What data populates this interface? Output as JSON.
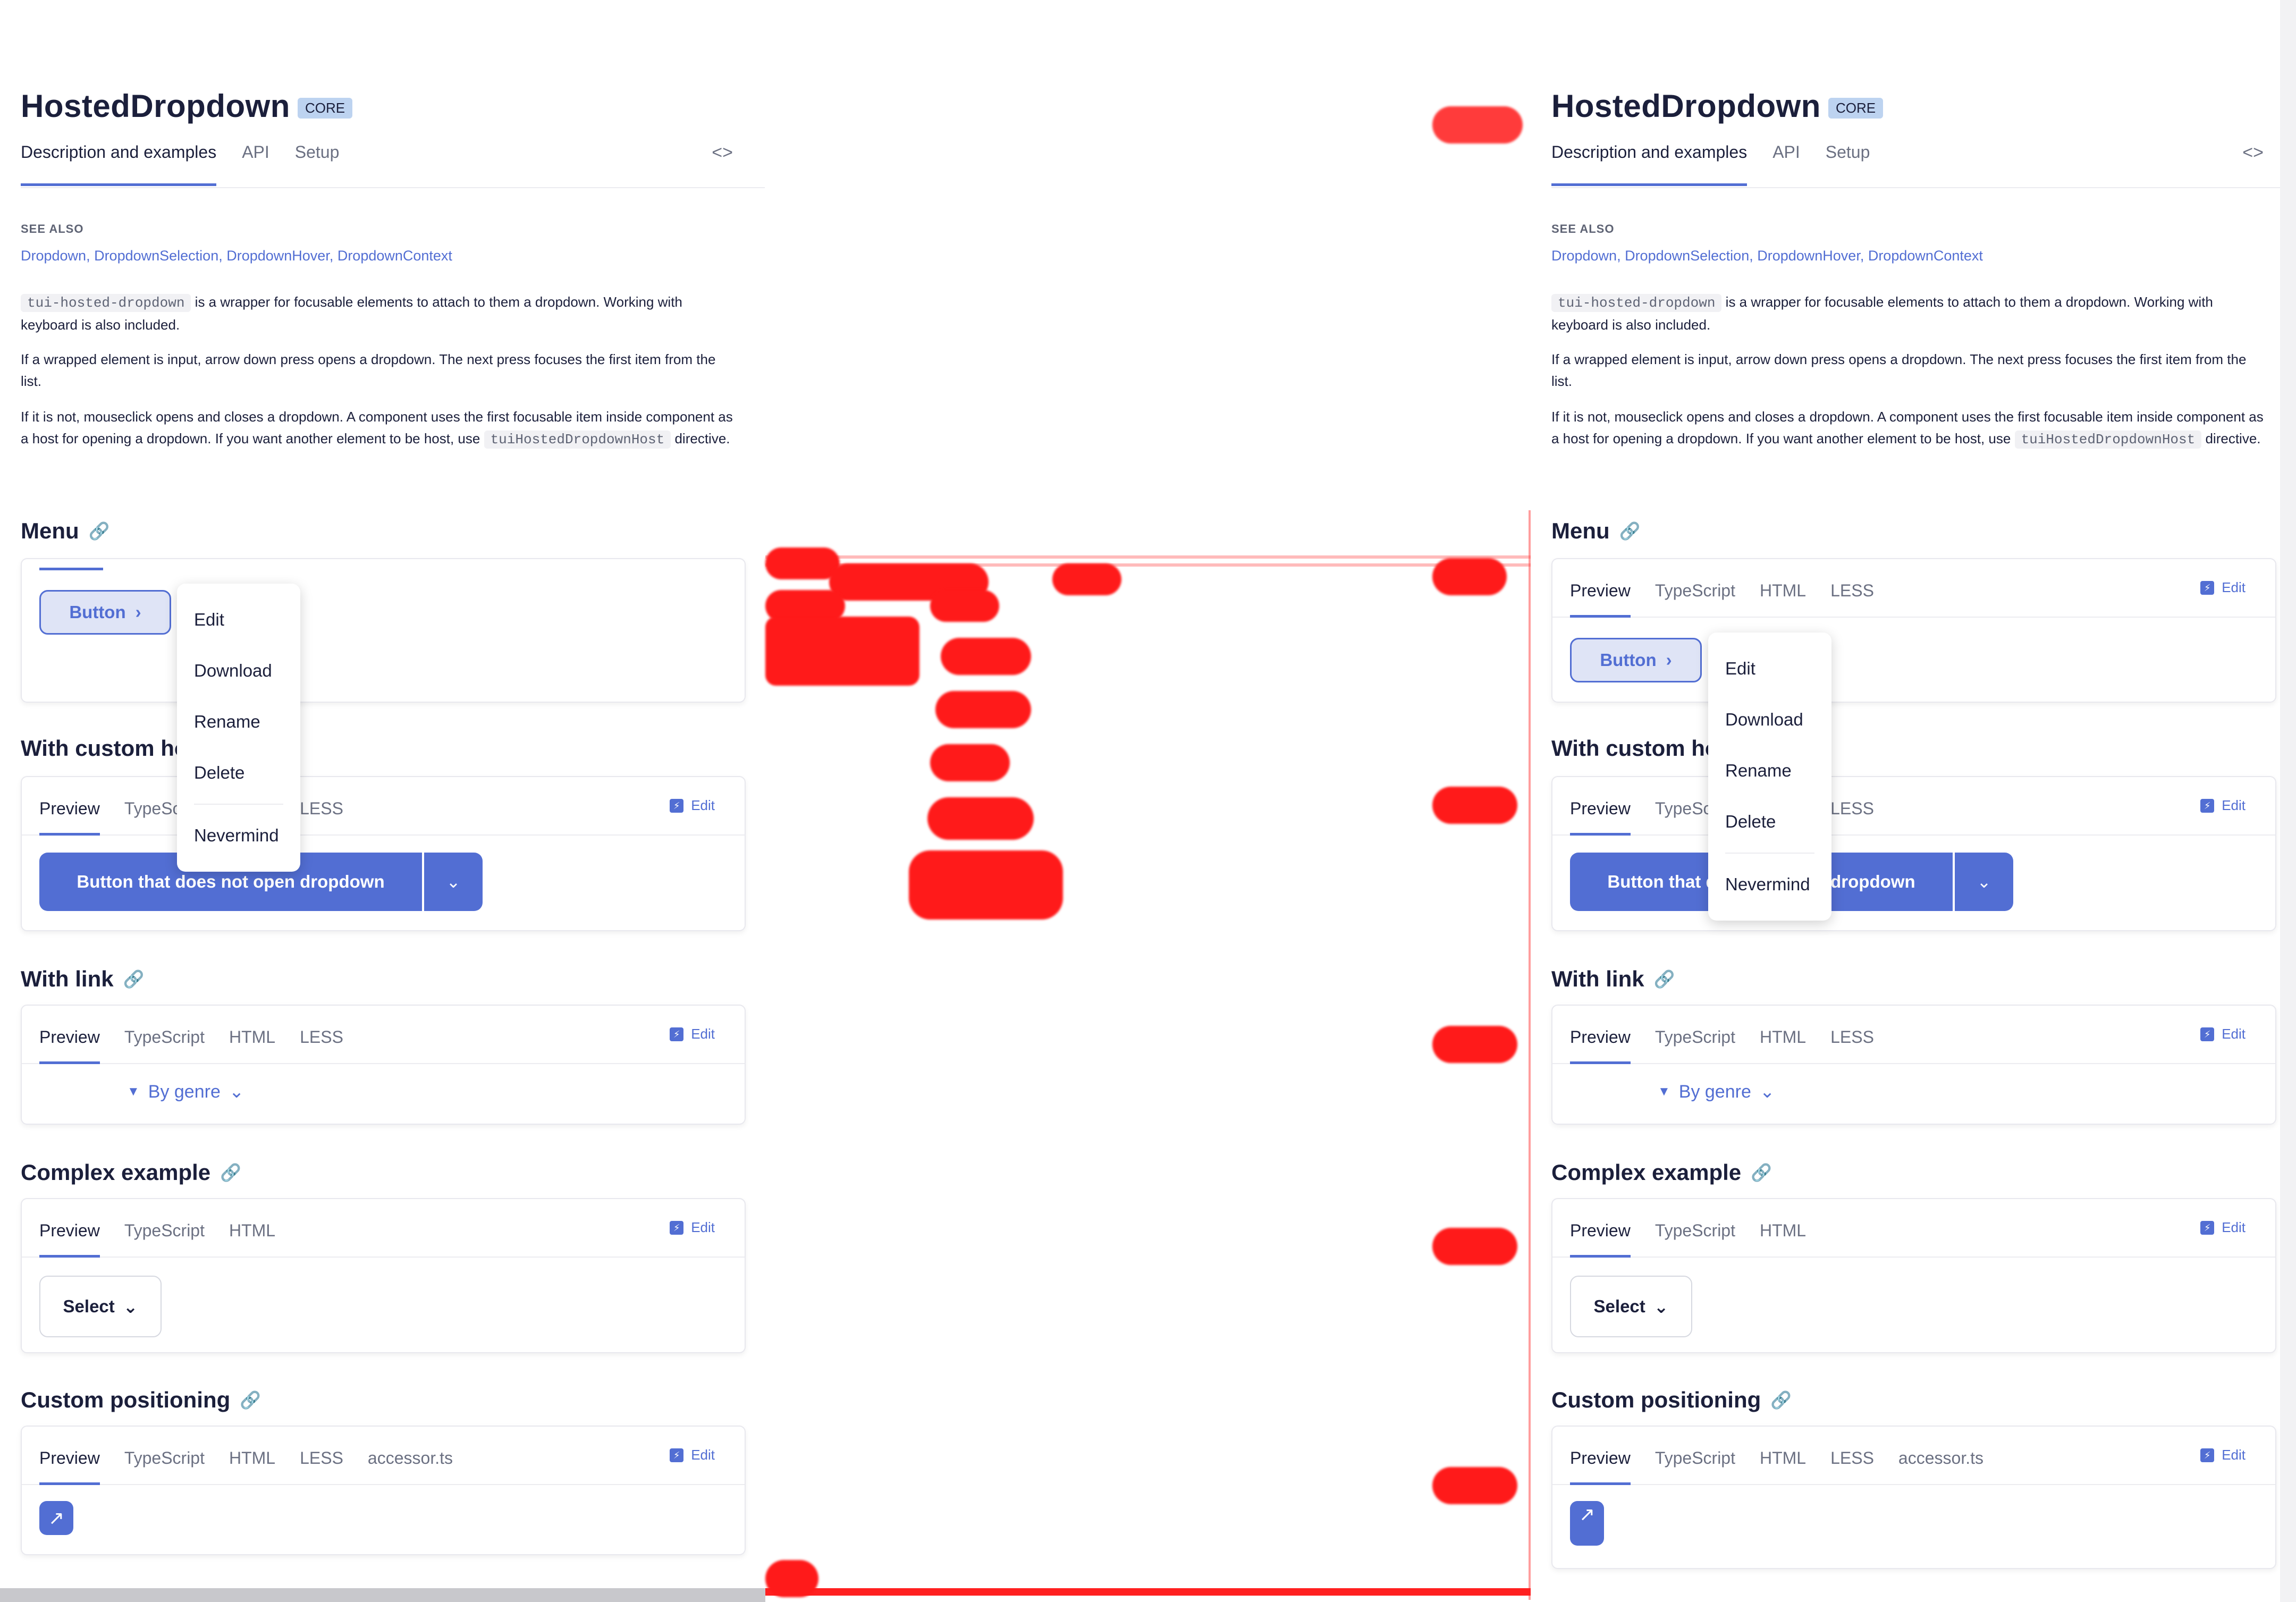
{
  "doc": {
    "title": "HostedDropdown",
    "badge": "CORE",
    "tabs": [
      "Description and examples",
      "API",
      "Setup"
    ],
    "code_toggle": "<>",
    "see_also_title": "SEE ALSO",
    "see_also_links": "Dropdown, DropdownSelection, DropdownHover, DropdownContext",
    "para1_code": "tui-hosted-dropdown",
    "para1_text": " is a wrapper for focusable elements to attach to them a dropdown. Working with keyboard is also included.",
    "para2": "If a wrapped element is input, arrow down press opens a dropdown. The next press focuses the first item from the list.",
    "para3_text": "If it is not, mouseclick opens and closes a dropdown. A component uses the first focusable item inside component as a host for opening a dropdown. If you want another element to be host, use ",
    "para3_code": "tuiHostedDropdownHost",
    "para3_tail": " directive."
  },
  "sections": {
    "menu": {
      "title": "Menu",
      "button": "Button"
    },
    "custom_host": {
      "title": "With custom host",
      "split_label": "Button that does not open dropdown"
    },
    "with_link": {
      "title": "With link",
      "genre": "By genre"
    },
    "complex": {
      "title": "Complex example",
      "select": "Select"
    },
    "custom_positioning": {
      "title": "Custom positioning"
    }
  },
  "card_tabs": {
    "basic": [
      "Preview",
      "TypeScript",
      "HTML",
      "LESS"
    ],
    "complex": [
      "Preview",
      "TypeScript",
      "HTML"
    ],
    "positioning": [
      "Preview",
      "TypeScript",
      "HTML",
      "LESS",
      "accessor.ts"
    ]
  },
  "edit_label": "Edit",
  "dropdown_menu": [
    "Edit",
    "Download",
    "Rename",
    "Delete",
    "Nevermind"
  ],
  "colors": {
    "accent": "#526ed3",
    "diff": "#ff1a1a"
  }
}
